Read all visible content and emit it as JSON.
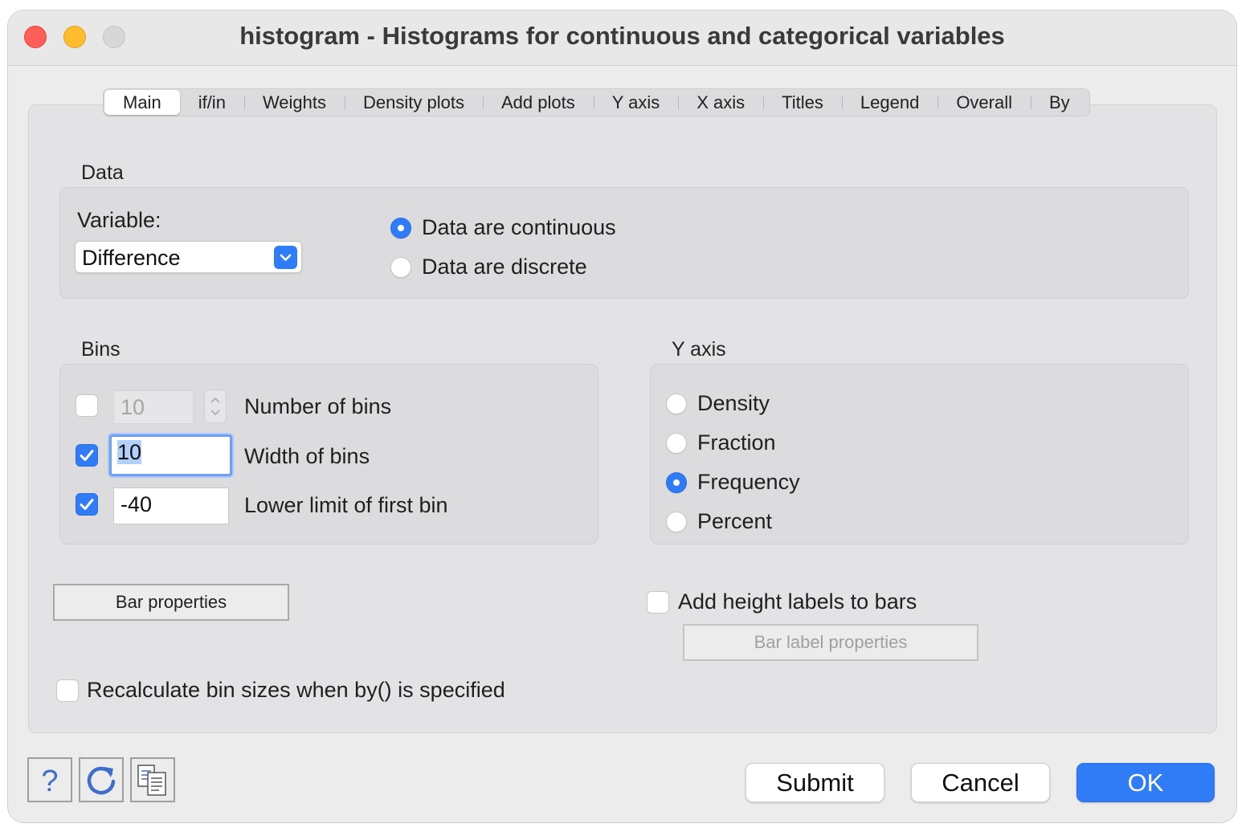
{
  "window": {
    "title": "histogram - Histograms for continuous and categorical variables"
  },
  "tabs": [
    "Main",
    "if/in",
    "Weights",
    "Density plots",
    "Add plots",
    "Y axis",
    "X axis",
    "Titles",
    "Legend",
    "Overall",
    "By"
  ],
  "active_tab": "Main",
  "data_group": {
    "title": "Data",
    "variable_label": "Variable:",
    "variable_value": "Difference",
    "continuous_label": "Data are continuous",
    "discrete_label": "Data are discrete",
    "selected": "continuous"
  },
  "bins_group": {
    "title": "Bins",
    "number_of_bins": {
      "checked": false,
      "value": "10",
      "label": "Number of bins"
    },
    "width_of_bins": {
      "checked": true,
      "value": "10",
      "label": "Width of bins"
    },
    "lower_limit": {
      "checked": true,
      "value": "-40",
      "label": "Lower limit of first bin"
    }
  },
  "yaxis_group": {
    "title": "Y axis",
    "options": [
      "Density",
      "Fraction",
      "Frequency",
      "Percent"
    ],
    "selected": "Frequency"
  },
  "bar_properties_label": "Bar properties",
  "height_labels": {
    "checked": false,
    "label": "Add height labels to bars"
  },
  "bar_label_properties_label": "Bar label properties",
  "recalculate": {
    "checked": false,
    "label": "Recalculate bin sizes when by() is specified"
  },
  "footer": {
    "help_icon": "question-mark-icon",
    "reset_icon": "refresh-icon",
    "copy_icon": "copy-command-icon",
    "submit_label": "Submit",
    "cancel_label": "Cancel",
    "ok_label": "OK"
  },
  "colors": {
    "accent": "#2f7cf6",
    "close": "#fe5f57",
    "minimize": "#febc2e"
  }
}
